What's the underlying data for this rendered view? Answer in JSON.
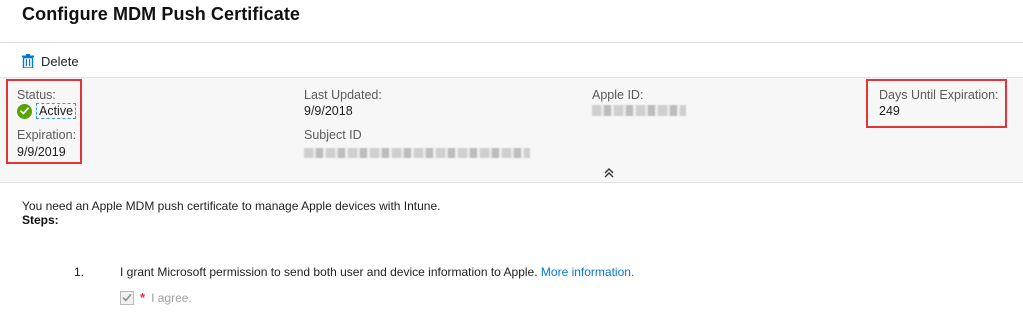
{
  "page": {
    "title": "Configure MDM Push Certificate"
  },
  "toolbar": {
    "delete_label": "Delete",
    "delete_icon": "trash-icon"
  },
  "info": {
    "status_label": "Status:",
    "status_value": "Active",
    "status_icon": "checkmark-circle-icon",
    "expiration_label": "Expiration:",
    "expiration_value": "9/9/2019",
    "last_updated_label": "Last Updated:",
    "last_updated_value": "9/9/2018",
    "subject_id_label": "Subject ID",
    "apple_id_label": "Apple ID:",
    "days_until_expiration_label": "Days Until Expiration:",
    "days_until_expiration_value": "249"
  },
  "body": {
    "intro": "You need an Apple MDM push certificate to manage Apple devices with Intune.",
    "steps_heading": "Steps:",
    "steps": [
      {
        "number": "1.",
        "text": "I grant Microsoft permission to send both user and device information to Apple.",
        "link_text": "More information.",
        "agree_label": "I agree.",
        "agree_checked": true
      }
    ]
  },
  "colors": {
    "accent": "#0078d4",
    "highlight": "#e0353b",
    "success": "#57a300"
  }
}
